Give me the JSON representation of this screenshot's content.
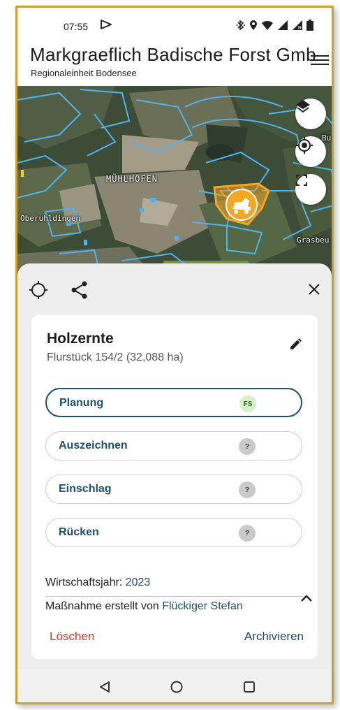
{
  "status_bar": {
    "time": "07:55",
    "icons": [
      "play-icon",
      "bluetooth-icon",
      "location-icon",
      "wifi-icon",
      "signal-icon",
      "signal-roaming-icon",
      "battery-icon"
    ]
  },
  "header": {
    "title": "Markgraeflich Badische Forst Gmb",
    "subtitle": "Regionaleinheit Bodensee",
    "menu_icon": "hamburger-menu-icon"
  },
  "map": {
    "labels": {
      "town_main": "MÜHLHOFEN",
      "town_west": "Oberuhldingen",
      "town_east": "Grasbeu",
      "town_ne": "Bu"
    },
    "controls": [
      "layers-icon",
      "my-location-icon",
      "fullscreen-icon"
    ],
    "marker_icon": "harvester-icon",
    "colors": {
      "parcel_outline": "#4fb3f0",
      "highlight": "#f5a623"
    }
  },
  "sheet": {
    "tools": [
      "target-icon",
      "share-icon",
      "close-icon"
    ],
    "card": {
      "title": "Holzernte",
      "subtitle": "Flurstück 154/2 (32,088 ha)",
      "steps": [
        {
          "label": "Planung",
          "badge": "FS",
          "active": true
        },
        {
          "label": "Auszeichnen",
          "badge": "?",
          "active": false
        },
        {
          "label": "Einschlag",
          "badge": "?",
          "active": false
        },
        {
          "label": "Rücken",
          "badge": "?",
          "active": false
        }
      ],
      "fiscal_year_label": "Wirtschaftsjahr:",
      "fiscal_year_value": "2023",
      "created_by_label": "Maßnahme erstellt von",
      "created_by_value": "Flückiger Stefan",
      "delete_label": "Löschen",
      "archive_label": "Archivieren"
    }
  },
  "nav_bar": [
    "back-icon",
    "home-icon",
    "recents-icon"
  ],
  "colors": {
    "accent": "#1f4f6b",
    "danger": "#d9342b",
    "frame": "#c9a227"
  }
}
